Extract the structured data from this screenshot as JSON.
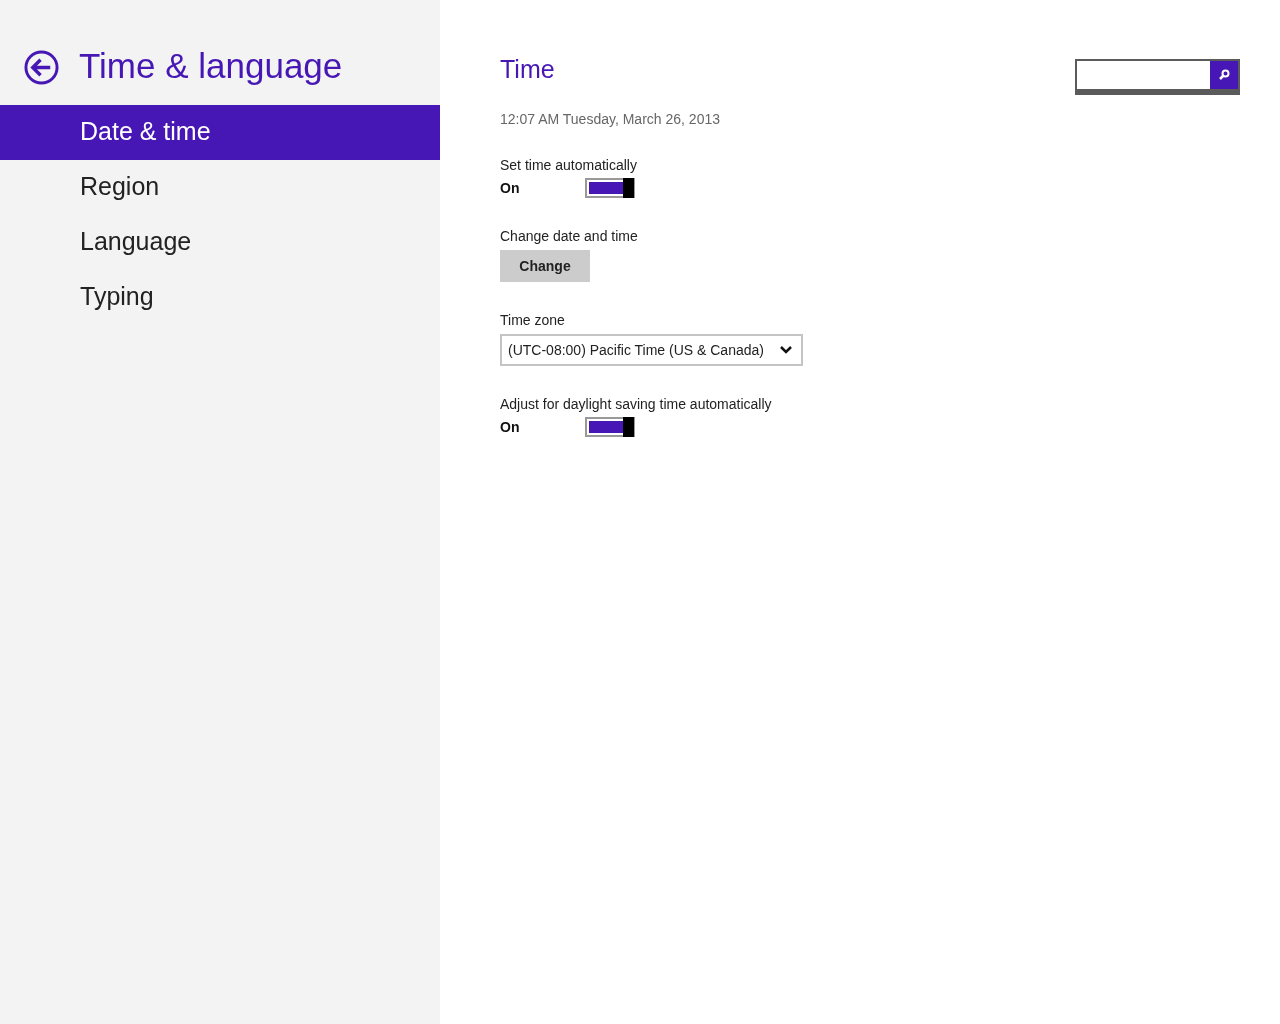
{
  "sidebar": {
    "title": "Time & language",
    "items": [
      {
        "label": "Date & time",
        "selected": true
      },
      {
        "label": "Region",
        "selected": false
      },
      {
        "label": "Language",
        "selected": false
      },
      {
        "label": "Typing",
        "selected": false
      }
    ]
  },
  "main": {
    "heading": "Time",
    "current_time": "12:07 AM Tuesday, March 26, 2013",
    "settings": [
      {
        "kind": "toggle",
        "label": "Set time automatically",
        "state_text": "On",
        "on": true
      },
      {
        "kind": "button",
        "label": "Change date and time",
        "button": "Change"
      },
      {
        "kind": "dropdown",
        "label": "Time zone",
        "value": "(UTC-08:00) Pacific Time (US & Canada)"
      },
      {
        "kind": "toggle",
        "label": "Adjust for daylight saving time automatically",
        "state_text": "On",
        "on": true
      }
    ]
  }
}
